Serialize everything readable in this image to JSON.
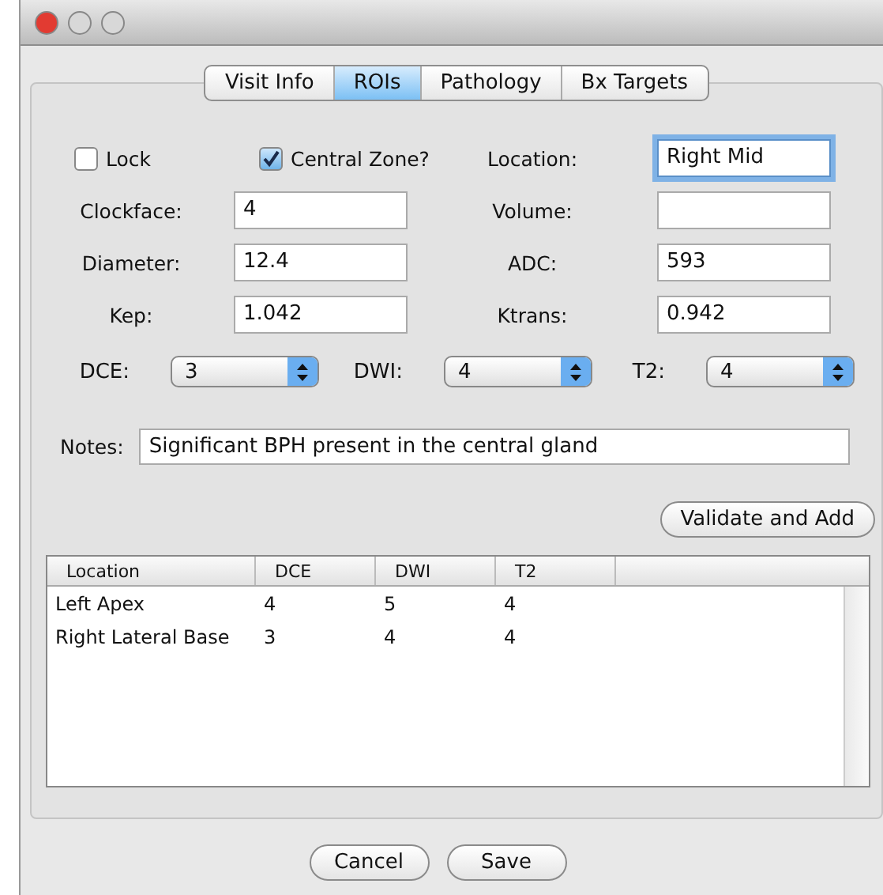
{
  "tabs": [
    {
      "label": "Visit Info",
      "selected": false
    },
    {
      "label": "ROIs",
      "selected": true
    },
    {
      "label": "Pathology",
      "selected": false
    },
    {
      "label": "Bx Targets",
      "selected": false
    }
  ],
  "checkboxes": [
    {
      "label": "Lock",
      "checked": false
    },
    {
      "label": "Central Zone?",
      "checked": true
    }
  ],
  "location": {
    "label": "Location:",
    "value": "Right Mid",
    "focused": true
  },
  "fields": [
    {
      "label": "Clockface:",
      "value": "4"
    },
    {
      "label": "Volume:"
    },
    {
      "label": "Diameter:",
      "value": "12.4"
    },
    {
      "label": "ADC:",
      "value": "593"
    },
    {
      "label": "Kep:",
      "value": "1.042"
    },
    {
      "label": "Ktrans:",
      "value": "0.942"
    }
  ],
  "dropdowns": [
    {
      "label": "DCE:",
      "value": "3"
    },
    {
      "label": "DWI:",
      "value": "4"
    },
    {
      "label": "T2:",
      "value": "4"
    }
  ],
  "notes": {
    "label": "Notes:",
    "value": "Significant BPH present in the central gland"
  },
  "validate_button": "Validate and Add",
  "table": {
    "columns": [
      "Location",
      "DCE",
      "DWI",
      "T2"
    ],
    "rows": [
      [
        "Left Apex",
        "4",
        "5",
        "4"
      ],
      [
        "Right Lateral Base",
        "3",
        "4",
        "4"
      ]
    ]
  },
  "buttons": [
    "Cancel",
    "Save"
  ]
}
